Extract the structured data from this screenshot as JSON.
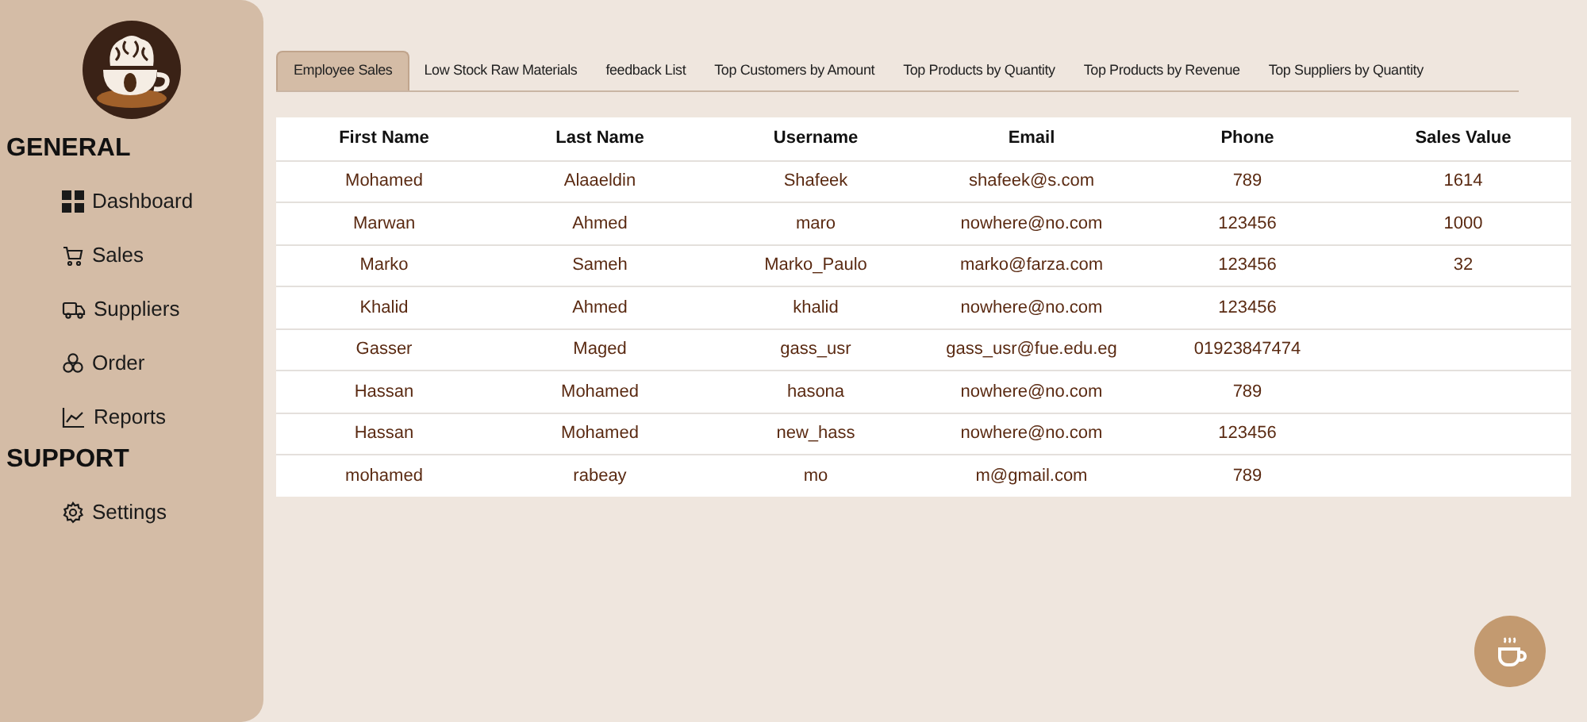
{
  "sidebar": {
    "sections": [
      {
        "title": "GENERAL",
        "items": [
          {
            "label": "Dashboard"
          },
          {
            "label": "Sales"
          },
          {
            "label": "Suppliers"
          },
          {
            "label": "Order"
          },
          {
            "label": "Reports"
          }
        ]
      },
      {
        "title": "SUPPORT",
        "items": [
          {
            "label": "Settings"
          }
        ]
      }
    ]
  },
  "tabs": [
    {
      "label": "Employee Sales",
      "selected": true
    },
    {
      "label": "Low Stock Raw Materials",
      "selected": false
    },
    {
      "label": "feedback List",
      "selected": false
    },
    {
      "label": "Top Customers by Amount",
      "selected": false
    },
    {
      "label": "Top Products by Quantity",
      "selected": false
    },
    {
      "label": "Top Products by Revenue",
      "selected": false
    },
    {
      "label": "Top Suppliers by Quantity",
      "selected": false
    }
  ],
  "table": {
    "columns": [
      "First Name",
      "Last Name",
      "Username",
      "Email",
      "Phone",
      "Sales Value"
    ],
    "rows": [
      [
        "Mohamed",
        "Alaaeldin",
        "Shafeek",
        "shafeek@s.com",
        "789",
        "1614"
      ],
      [
        "Marwan",
        "Ahmed",
        "maro",
        "nowhere@no.com",
        "123456",
        "1000"
      ],
      [
        "Marko",
        "Sameh",
        "Marko_Paulo",
        "marko@farza.com",
        "123456",
        "32"
      ],
      [
        "Khalid",
        "Ahmed",
        "khalid",
        "nowhere@no.com",
        "123456",
        ""
      ],
      [
        "Gasser",
        "Maged",
        "gass_usr",
        "gass_usr@fue.edu.eg",
        "01923847474",
        ""
      ],
      [
        "Hassan",
        "Mohamed",
        "hasona",
        "nowhere@no.com",
        "789",
        ""
      ],
      [
        "Hassan",
        "Mohamed",
        "new_hass",
        "nowhere@no.com",
        "123456",
        ""
      ],
      [
        "mohamed",
        "rabeay",
        "mo",
        "m@gmail.com",
        "789",
        ""
      ]
    ]
  }
}
